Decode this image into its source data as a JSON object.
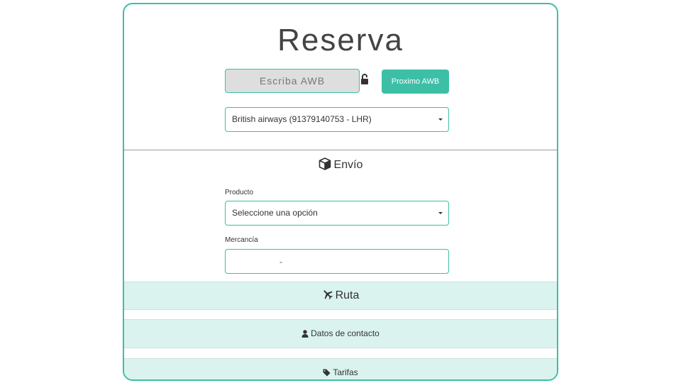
{
  "page": {
    "title": "Reserva"
  },
  "awb": {
    "placeholder": "Escriba AWB",
    "next_button_label": "Proximo AWB"
  },
  "airline": {
    "selected": "British airways (91379140753 - LHR)"
  },
  "envio": {
    "title": "Envío",
    "product_label": "Producto",
    "product_selected": "Seleccione una opción",
    "merchandise_label": "Mercancía",
    "merchandise_value": "-"
  },
  "sections": {
    "ruta": "Ruta",
    "contacto": "Datos de contacto",
    "tarifas": "Tarifas"
  },
  "icons": {
    "lock": "unlocked-padlock-icon",
    "envio": "box-icon",
    "ruta": "airplane-icon",
    "contacto": "user-icon",
    "tarifas": "tag-icon"
  },
  "colors": {
    "accent": "#3dbfa6",
    "section_bg": "#daf3ee",
    "input_bg": "#dedede"
  }
}
